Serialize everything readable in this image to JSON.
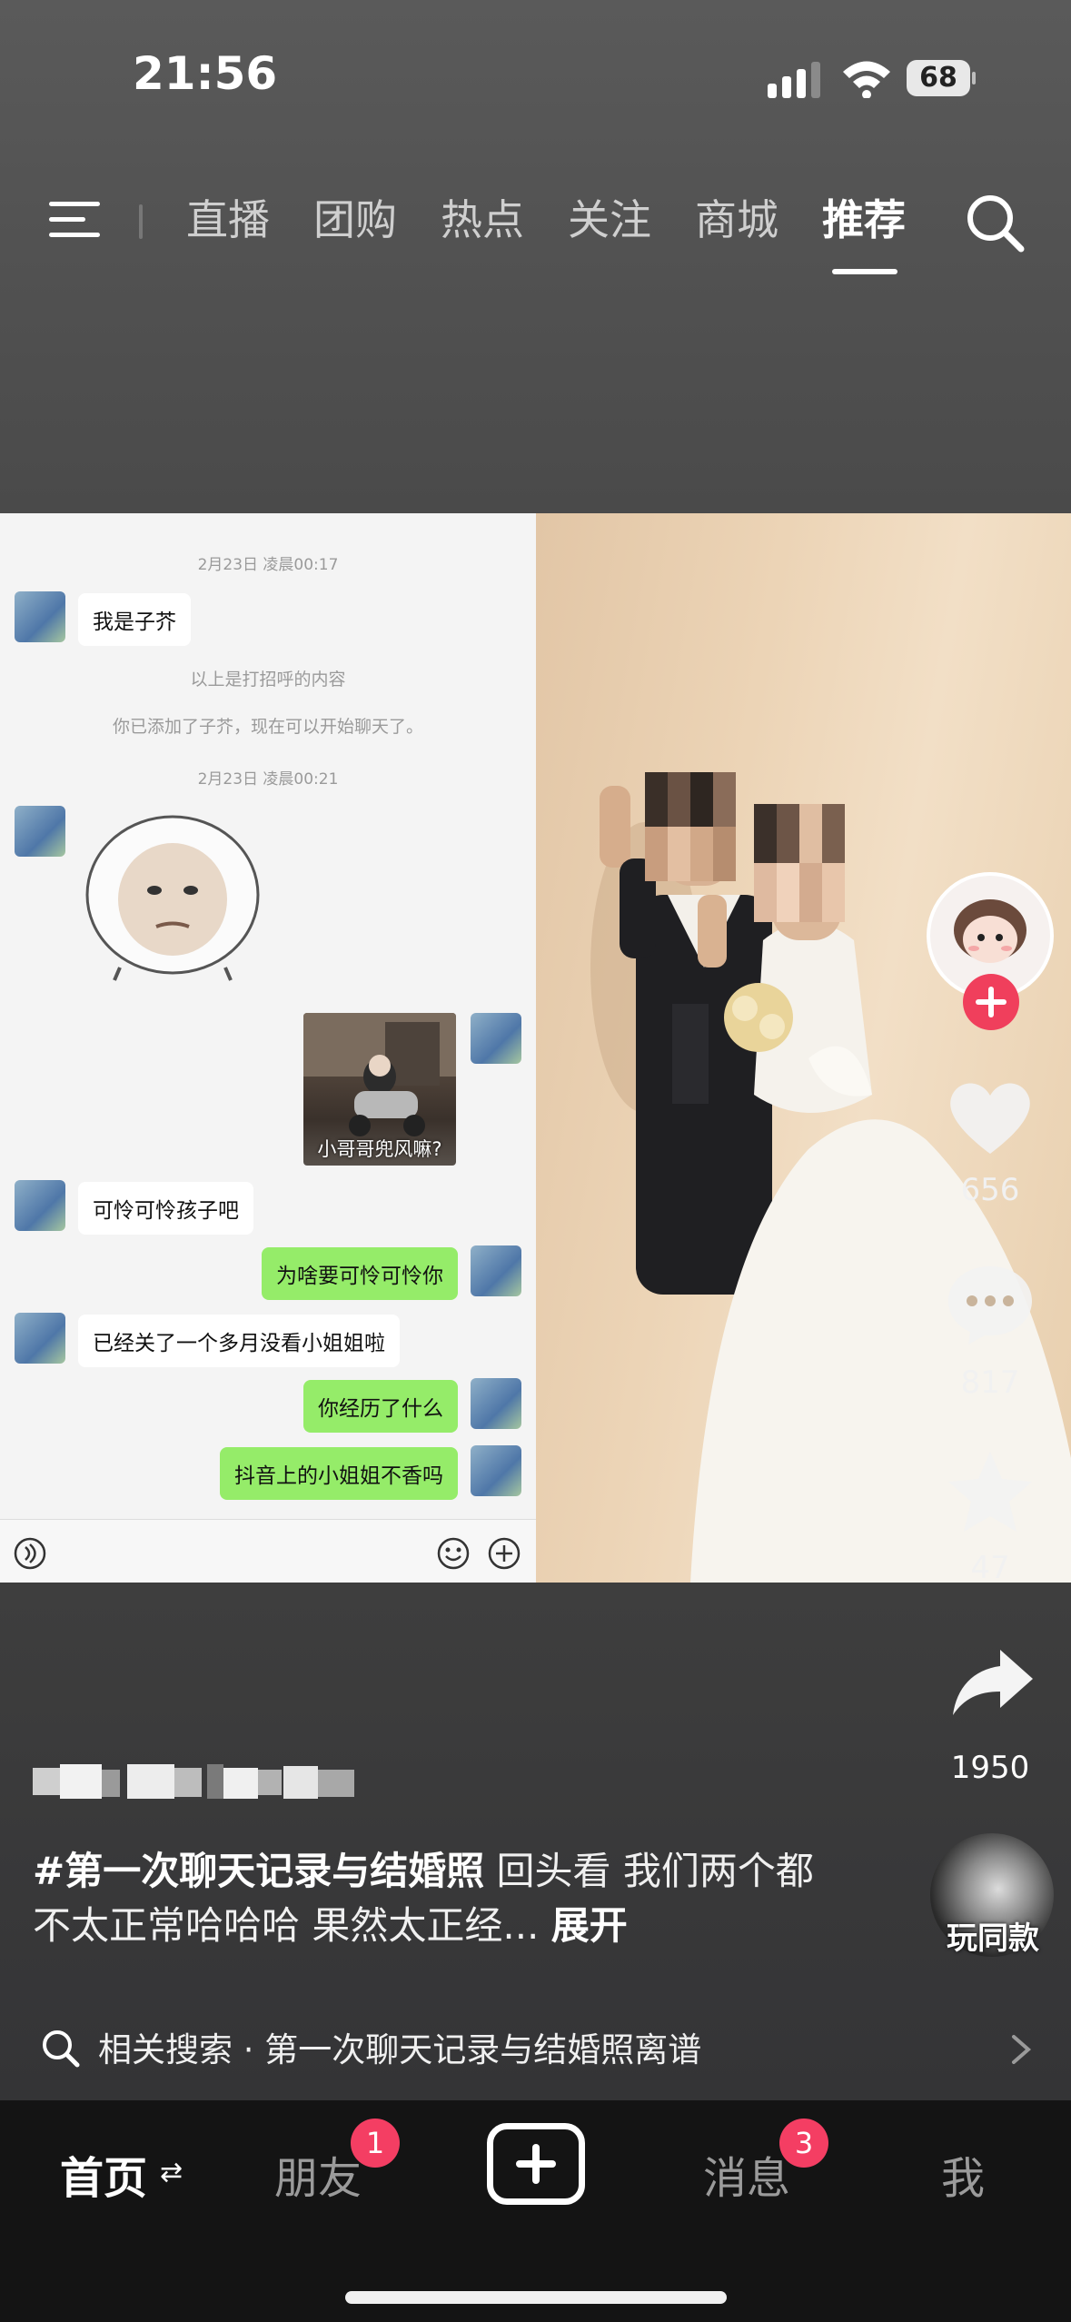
{
  "status_bar": {
    "time": "21:56",
    "battery": "68"
  },
  "top_nav": {
    "tabs": [
      "直播",
      "团购",
      "热点",
      "关注",
      "商城",
      "推荐"
    ],
    "active_tab": "推荐"
  },
  "chat": {
    "time1": "2月23日 凌晨00:17",
    "msg_hello": "我是子芥",
    "sys1": "以上是打招呼的内容",
    "sys2": "你已添加了子芥，现在可以开始聊天了。",
    "time2": "2月23日 凌晨00:21",
    "image_caption": "小哥哥兜风嘛?",
    "msg1": "可怜可怜孩子吧",
    "msg2": "为啥要可怜可怜你",
    "msg3": "已经关了一个多月没看小姐姐啦",
    "msg4": "你经历了什么",
    "msg5": "抖音上的小姐姐不香吗"
  },
  "actions": {
    "likes": "656",
    "comments": "817",
    "favorites": "47",
    "shares": "1950",
    "remix_label": "玩同款"
  },
  "post": {
    "hashtag": "#第一次聊天记录与结婚照",
    "caption_rest": " 回头看 我们两个都不太正常哈哈哈 果然太正经...",
    "expand_label": "展开"
  },
  "related_search": {
    "prefix": "相关搜索 · ",
    "query": "第一次聊天记录与结婚照离谱"
  },
  "bottom_tabs": {
    "home": "首页",
    "friends": "朋友",
    "friends_badge": "1",
    "messages": "消息",
    "messages_badge": "3",
    "me": "我"
  },
  "colors": {
    "badge": "#f43e63",
    "follow_button": "#f03f5c",
    "wechat_green_bubble": "#95ec69",
    "tabbar_bg": "#141414"
  }
}
